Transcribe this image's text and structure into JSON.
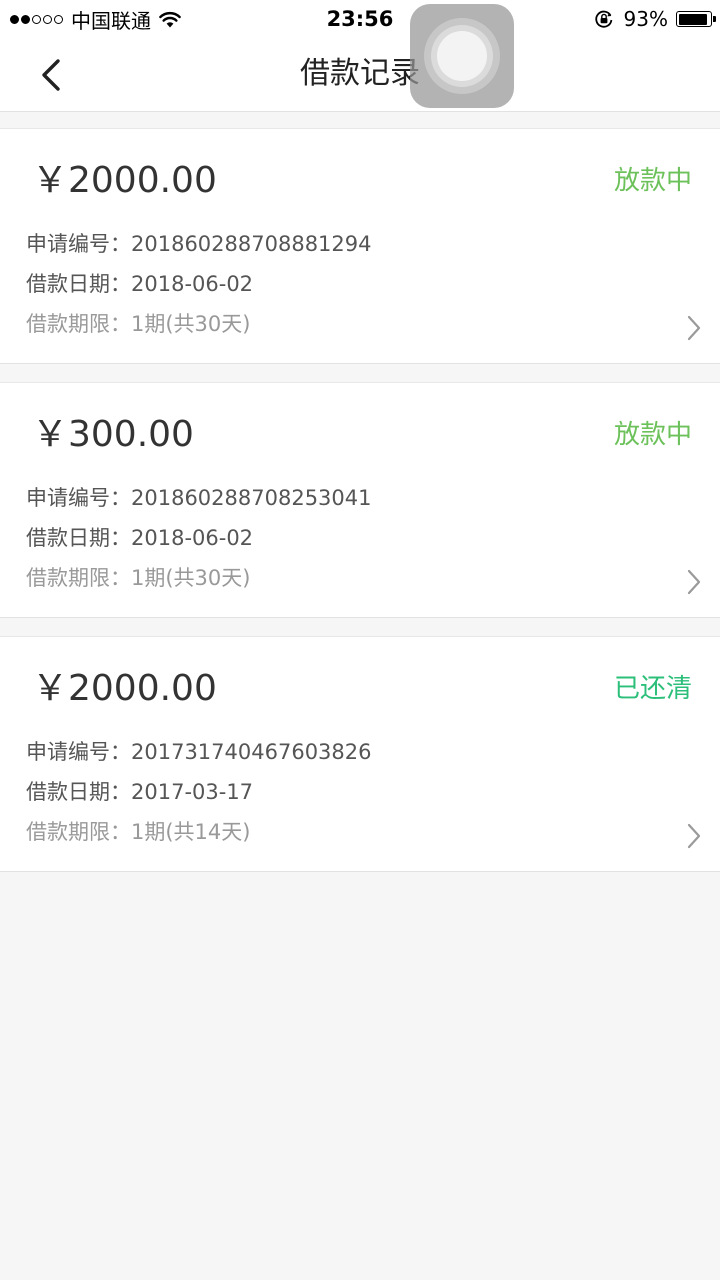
{
  "status_bar": {
    "carrier": "中国联通",
    "time": "23:56",
    "battery_percent": "93%",
    "battery_level": 0.93,
    "signal_bars": 2,
    "signal_total": 5
  },
  "nav": {
    "title": "借款记录",
    "back_icon": "chevron-left-icon"
  },
  "colors": {
    "status_disbursing": "#6cc15a",
    "status_settled": "#2cbf7a",
    "background": "#f6f6f6"
  },
  "loans": [
    {
      "amount": "￥2000.00",
      "status": "放款中",
      "status_type": "disbursing",
      "application_no_label": "申请编号：",
      "application_no": "201860288708881294",
      "loan_date_label": "借款日期：",
      "loan_date": "2018-06-02",
      "term_label": "借款期限：",
      "term": "1期(共30天)"
    },
    {
      "amount": "￥300.00",
      "status": "放款中",
      "status_type": "disbursing",
      "application_no_label": "申请编号：",
      "application_no": "201860288708253041",
      "loan_date_label": "借款日期：",
      "loan_date": "2018-06-02",
      "term_label": "借款期限：",
      "term": "1期(共30天)"
    },
    {
      "amount": "￥2000.00",
      "status": "已还清",
      "status_type": "settled",
      "application_no_label": "申请编号：",
      "application_no": "201731740467603826",
      "loan_date_label": "借款日期：",
      "loan_date": "2017-03-17",
      "term_label": "借款期限：",
      "term": "1期(共14天)"
    }
  ]
}
